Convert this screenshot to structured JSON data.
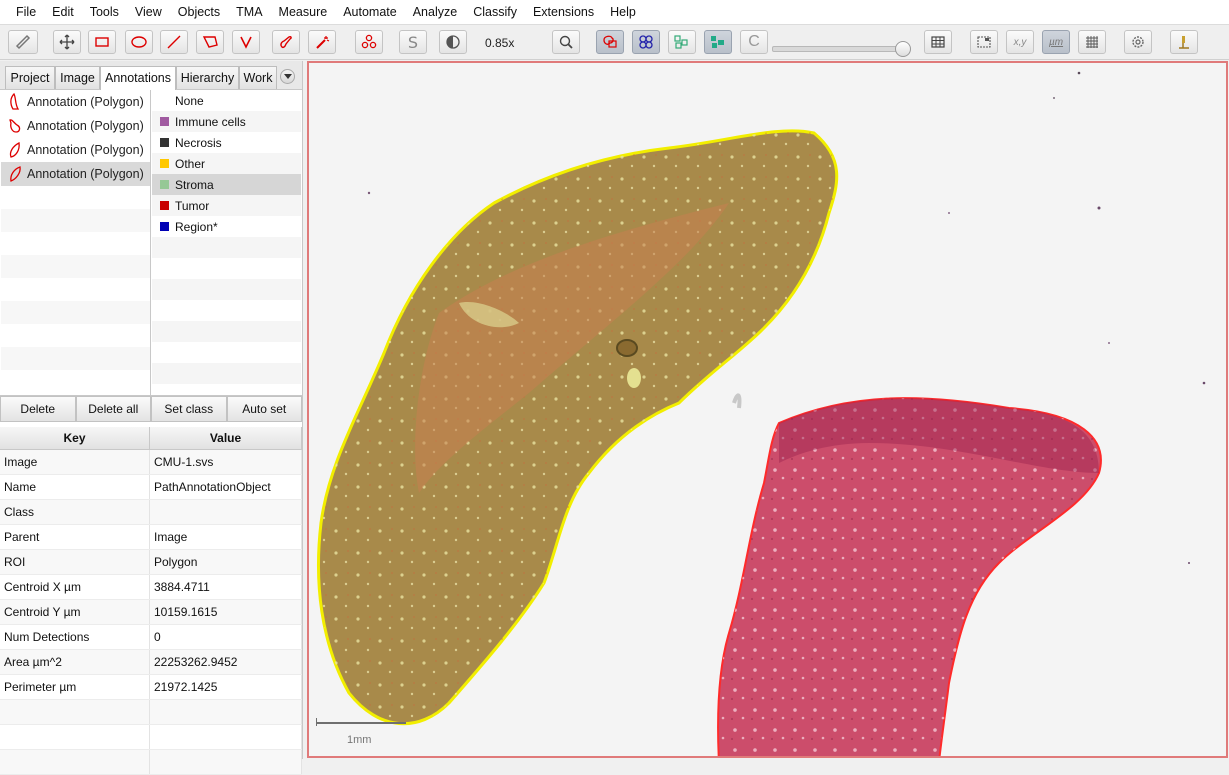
{
  "menubar": {
    "items": [
      "File",
      "Edit",
      "Tools",
      "View",
      "Objects",
      "TMA",
      "Measure",
      "Automate",
      "Analyze",
      "Classify",
      "Extensions",
      "Help"
    ]
  },
  "toolbar": {
    "zoom": "0.85x",
    "tools": [
      "move-icon",
      "rectangle-icon",
      "ellipse-icon",
      "line-icon",
      "polygon-icon",
      "polyline-icon",
      "brush-icon",
      "wand-icon",
      "points-icon",
      "selection-mode-icon",
      "brightness-contrast-icon",
      "zoom-to-fit-icon",
      "show-annotations-icon",
      "show-tma-grid-icon",
      "show-detections-icon",
      "fill-detections-icon",
      "show-connections-icon",
      "opacity-slider",
      "measurement-table-icon",
      "overview-icon",
      "location-icon",
      "scalebar-icon",
      "grid-icon",
      "settings-icon",
      "log-icon"
    ]
  },
  "tabs": [
    "Project",
    "Image",
    "Annotations",
    "Hierarchy",
    "Work"
  ],
  "active_tab": "Annotations",
  "annotations": [
    {
      "label": "Annotation (Polygon)",
      "color": "#d40000"
    },
    {
      "label": "Annotation (Polygon)",
      "color": "#d40000"
    },
    {
      "label": "Annotation (Polygon)",
      "color": "#d40000"
    },
    {
      "label": "Annotation (Polygon)",
      "color": "#d40000"
    }
  ],
  "classes": [
    {
      "label": "None",
      "color": ""
    },
    {
      "label": "Immune cells",
      "color": "#a05aa0"
    },
    {
      "label": "Necrosis",
      "color": "#333333"
    },
    {
      "label": "Other",
      "color": "#ffc800"
    },
    {
      "label": "Stroma",
      "color": "#96c896"
    },
    {
      "label": "Tumor",
      "color": "#c80000"
    },
    {
      "label": "Region*",
      "color": "#0000b4"
    }
  ],
  "buttons": {
    "delete": "Delete",
    "delete_all": "Delete all",
    "set_class": "Set class",
    "auto_set": "Auto set"
  },
  "properties": {
    "key_header": "Key",
    "value_header": "Value",
    "rows": [
      {
        "key": "Image",
        "value": "CMU-1.svs"
      },
      {
        "key": "Name",
        "value": "PathAnnotationObject"
      },
      {
        "key": "Class",
        "value": ""
      },
      {
        "key": "Parent",
        "value": "Image"
      },
      {
        "key": "ROI",
        "value": "Polygon"
      },
      {
        "key": "Centroid X µm",
        "value": "3884.4711"
      },
      {
        "key": "Centroid Y µm",
        "value": "10159.1615"
      },
      {
        "key": "Num Detections",
        "value": "0"
      },
      {
        "key": "Area µm^2",
        "value": "22253262.9452"
      },
      {
        "key": "Perimeter µm",
        "value": "21972.1425"
      }
    ]
  },
  "viewer": {
    "scale_label": "1mm"
  },
  "colors": {
    "selected_outline": "#ffff00",
    "annotation_outline": "#ff2020",
    "tissue_brown": "#a88a4a",
    "tissue_pink": "#d0506a"
  }
}
